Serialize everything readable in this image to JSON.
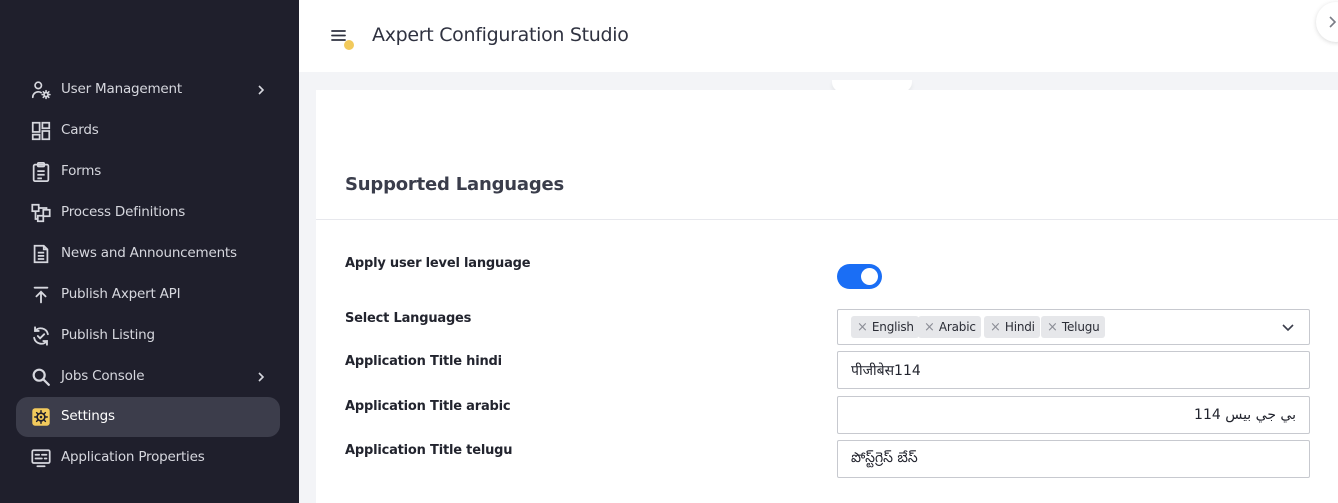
{
  "sidebar": {
    "items": [
      {
        "label": "User Management",
        "icon": "user-gear-icon",
        "has_submenu": true
      },
      {
        "label": "Cards",
        "icon": "dashboard-icon",
        "has_submenu": false
      },
      {
        "label": "Forms",
        "icon": "clipboard-icon",
        "has_submenu": false
      },
      {
        "label": "Process Definitions",
        "icon": "flowchart-icon",
        "has_submenu": false
      },
      {
        "label": "News and Announcements",
        "icon": "document-icon",
        "has_submenu": false
      },
      {
        "label": "Publish Axpert API",
        "icon": "upload-icon",
        "has_submenu": false
      },
      {
        "label": "Publish Listing",
        "icon": "sync-check-icon",
        "has_submenu": false
      },
      {
        "label": "Jobs Console",
        "icon": "search-icon",
        "has_submenu": true
      },
      {
        "label": "Settings",
        "icon": "settings-icon",
        "has_submenu": false,
        "active": true
      },
      {
        "label": "Application Properties",
        "icon": "properties-icon",
        "has_submenu": false
      }
    ]
  },
  "header": {
    "title": "Axpert Configuration Studio"
  },
  "main": {
    "section_title": "Supported Languages",
    "fields": {
      "apply_user_level_language": {
        "label": "Apply user level language",
        "enabled": true
      },
      "select_languages": {
        "label": "Select Languages",
        "selected": [
          "English",
          "Arabic",
          "Hindi",
          "Telugu"
        ]
      },
      "title_hindi": {
        "label": "Application Title hindi",
        "value": "पीजीबेस114"
      },
      "title_arabic": {
        "label": "Application Title arabic",
        "value": "بي جي بيس 114"
      },
      "title_telugu": {
        "label": "Application Title telugu",
        "value": "పోస్ట్‌గ్రెస్ బేస్"
      }
    }
  },
  "colors": {
    "sidebar_bg": "#1f1f2c",
    "active_item_bg": "#3c3d4b",
    "accent_yellow": "#f2ca5c",
    "toggle_blue": "#1a6ef5"
  }
}
